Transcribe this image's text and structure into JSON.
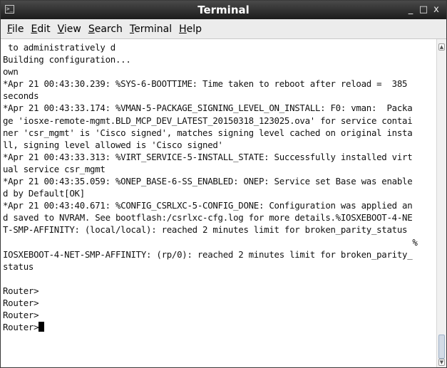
{
  "window": {
    "title": "Terminal",
    "app_icon": "terminal-icon",
    "controls": {
      "minimize_glyph": "_",
      "maximize_glyph": "□",
      "close_glyph": "x"
    }
  },
  "menu": {
    "items": [
      {
        "accel": "F",
        "rest": "ile"
      },
      {
        "accel": "E",
        "rest": "dit"
      },
      {
        "accel": "V",
        "rest": "iew"
      },
      {
        "accel": "S",
        "rest": "earch"
      },
      {
        "accel": "T",
        "rest": "erminal"
      },
      {
        "accel": "H",
        "rest": "elp"
      }
    ]
  },
  "terminal": {
    "lines": [
      " to administratively d",
      "Building configuration...",
      "own",
      "*Apr 21 00:43:30.239: %SYS-6-BOOTTIME: Time taken to reboot after reload =  385",
      "seconds",
      "*Apr 21 00:43:33.174: %VMAN-5-PACKAGE_SIGNING_LEVEL_ON_INSTALL: F0: vman:  Packa",
      "ge 'iosxe-remote-mgmt.BLD_MCP_DEV_LATEST_20150318_123025.ova' for service contai",
      "ner 'csr_mgmt' is 'Cisco signed', matches signing level cached on original insta",
      "ll, signing level allowed is 'Cisco signed'",
      "*Apr 21 00:43:33.313: %VIRT_SERVICE-5-INSTALL_STATE: Successfully installed virt",
      "ual service csr_mgmt",
      "*Apr 21 00:43:35.059: %ONEP_BASE-6-SS_ENABLED: ONEP: Service set Base was enable",
      "d by Default[OK]",
      "*Apr 21 00:43:40.671: %CONFIG_CSRLXC-5-CONFIG_DONE: Configuration was applied an",
      "d saved to NVRAM. See bootflash:/csrlxc-cfg.log for more details.%IOSXEBOOT-4-NE",
      "T-SMP-AFFINITY: (local/local): reached 2 minutes limit for broken_parity_status",
      "                                                                                %",
      "IOSXEBOOT-4-NET-SMP-AFFINITY: (rp/0): reached 2 minutes limit for broken_parity_",
      "status",
      "",
      "Router>",
      "Router>",
      "Router>",
      "Router>"
    ],
    "cursor": "block"
  },
  "scrollbar": {
    "up_icon": "scroll-up-arrow-icon",
    "down_icon": "scroll-down-arrow-icon",
    "position": 0.95
  }
}
